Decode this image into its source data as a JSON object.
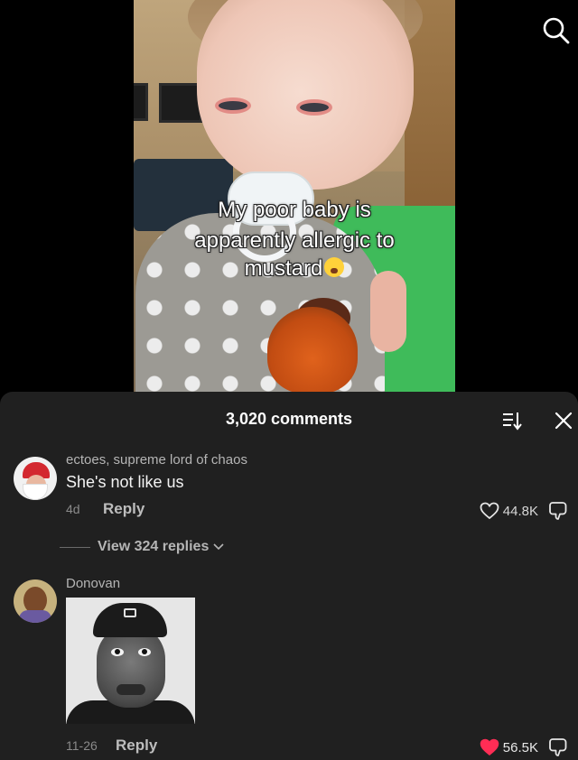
{
  "video": {
    "caption_lines": [
      "My poor baby is",
      "apparently allergic to",
      "mustard"
    ],
    "caption_emoji_icon": "crying-face-emoji"
  },
  "header": {
    "search_icon": "search-icon"
  },
  "comments_sheet": {
    "title": "3,020 comments",
    "sort_icon": "sort-icon",
    "close_icon": "close-icon",
    "comments": [
      {
        "username": "ectoes, supreme lord of chaos",
        "text": "She's not like us",
        "date": "4d",
        "reply_label": "Reply",
        "likes": "44.8K",
        "liked": false,
        "view_replies": "View 324 replies"
      },
      {
        "username": "Donovan",
        "text": "",
        "date": "11-26",
        "reply_label": "Reply",
        "likes": "56.5K",
        "liked": true
      }
    ],
    "colors": {
      "background": "#202020",
      "liked_heart": "#ff2d55"
    }
  }
}
